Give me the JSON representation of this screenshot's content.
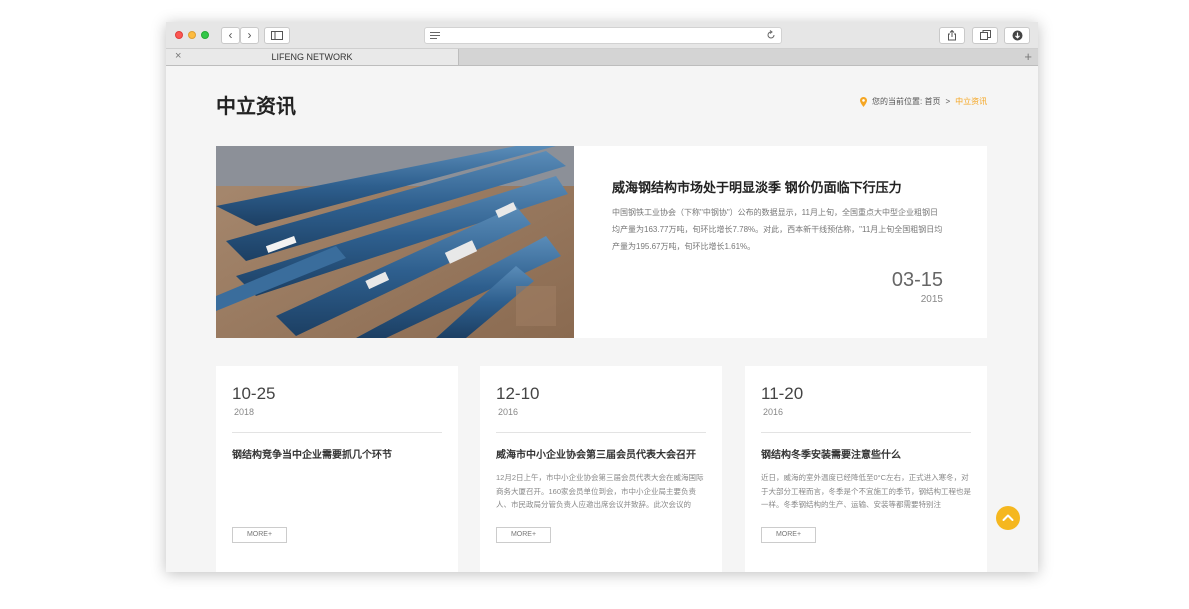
{
  "browser": {
    "tab_title": "LIFENG NETWORK",
    "tab_close": "×",
    "new_tab": "+",
    "back": "‹",
    "forward": "›"
  },
  "page": {
    "title": "中立资讯",
    "breadcrumb": {
      "prefix": "您的当前位置:",
      "home": "首页",
      "separator": ">",
      "current": "中立资讯"
    }
  },
  "feature": {
    "image_alt": "steel-structure-beams-photo",
    "title": "威海钢结构市场处于明显淡季 钢价仍面临下行压力",
    "text": "中国钢铁工业协会（下称\"中钢协\"）公布的数据显示，11月上旬，全国重点大中型企业粗钢日均产量为163.77万吨，旬环比增长7.78%。对此，西本新干线预估称，\"11月上旬全国粗钢日均产量为195.67万吨，旬环比增长1.61%。",
    "date": "03-15",
    "year": "2015"
  },
  "cards": [
    {
      "date": "10-25",
      "year": "2018",
      "title": "钢结构竞争当中企业需要抓几个环节",
      "text": "",
      "more": "MORE+"
    },
    {
      "date": "12-10",
      "year": "2016",
      "title": "威海市中小企业协会第三届会员代表大会召开",
      "text": "12月2日上午，市中小企业协会第三届会员代表大会在威海国际商务大厦召开。160家会员单位到会，市中小企业局主要负责人、市民政局分管负责人应邀出席会议并致辞。此次会议的",
      "more": "MORE+"
    },
    {
      "date": "11-20",
      "year": "2016",
      "title": "钢结构冬季安装需要注意些什么",
      "text": "近日，威海的室外温度已经降低至0°C左右，正式进入寒冬，对于大部分工程而言，冬季是个不宜施工的季节，钢结构工程也是一样。冬季钢结构的生产、运输、安装等都需要特别注",
      "more": "MORE+"
    }
  ],
  "colors": {
    "accent": "#f5a623",
    "scroll_top_bg": "#f5b71f",
    "page_bg": "#f5f5f5"
  },
  "icons": {
    "location": "location-pin-icon",
    "scroll_top": "chevron-up-icon"
  }
}
